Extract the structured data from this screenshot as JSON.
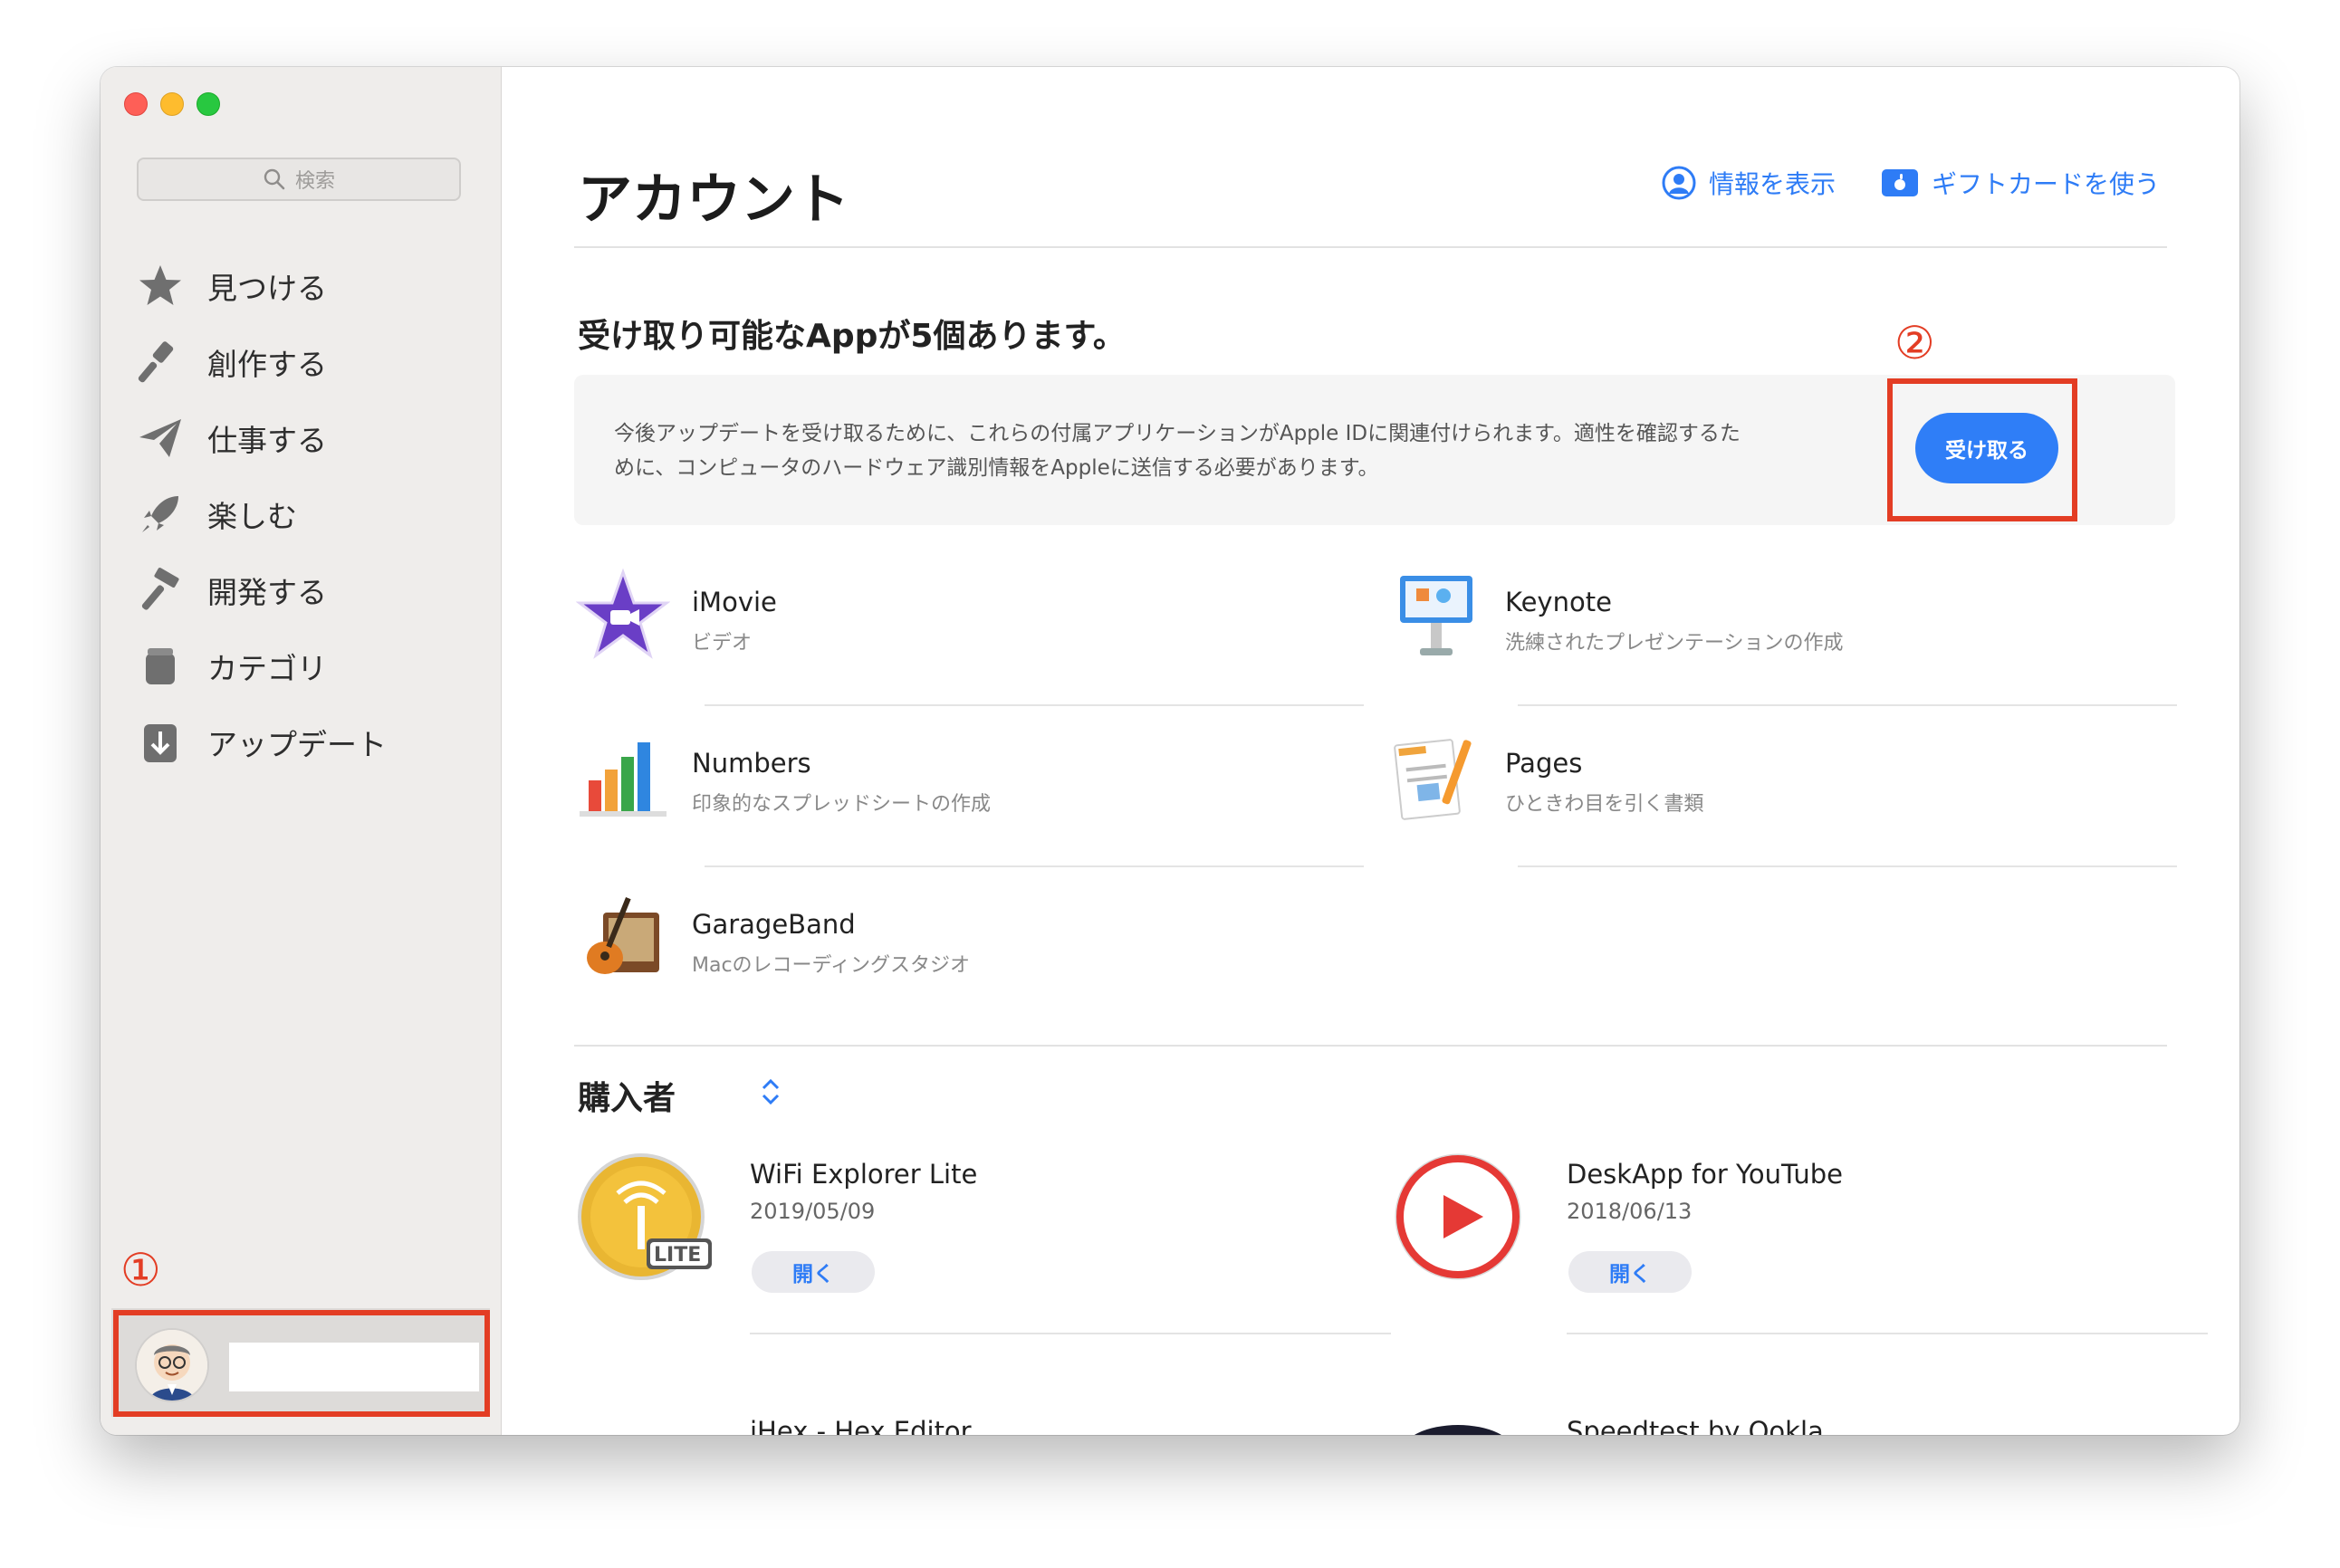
{
  "sidebar": {
    "search_placeholder": "検索",
    "items": [
      {
        "label": "見つける",
        "icon": "star-icon"
      },
      {
        "label": "創作する",
        "icon": "brush-icon"
      },
      {
        "label": "仕事する",
        "icon": "paper-plane-icon"
      },
      {
        "label": "楽しむ",
        "icon": "rocket-icon"
      },
      {
        "label": "開発する",
        "icon": "hammer-icon"
      },
      {
        "label": "カテゴリ",
        "icon": "categories-icon"
      },
      {
        "label": "アップデート",
        "icon": "download-icon"
      }
    ]
  },
  "annotations": {
    "marker_1": "①",
    "marker_2": "②"
  },
  "header": {
    "title": "アカウント",
    "view_info": "情報を表示",
    "gift_card": "ギフトカードを使う"
  },
  "bundled": {
    "heading": "受け取り可能なAppが5個あります。",
    "notice_line1": "今後アップデートを受け取るために、これらの付属アプリケーションがApple IDに関連付けられます。適性を確認するた",
    "notice_line2": "めに、コンピュータのハードウェア識別情報をAppleに送信する必要があります。",
    "redeem_label": "受け取る",
    "apps": [
      {
        "name": "iMovie",
        "desc": "ビデオ"
      },
      {
        "name": "Keynote",
        "desc": "洗練されたプレゼンテーションの作成"
      },
      {
        "name": "Numbers",
        "desc": "印象的なスプレッドシートの作成"
      },
      {
        "name": "Pages",
        "desc": "ひときわ目を引く書類"
      },
      {
        "name": "GarageBand",
        "desc": "Macのレコーディングスタジオ"
      }
    ]
  },
  "purchased": {
    "heading": "購入者",
    "items": [
      {
        "name": "WiFi Explorer Lite",
        "date": "2019/05/09",
        "action": "開く"
      },
      {
        "name": "DeskApp for YouTube",
        "date": "2018/06/13",
        "action": "開く"
      },
      {
        "name": "iHex - Hex Editor"
      },
      {
        "name": "Speedtest by Ookla"
      }
    ]
  },
  "colors": {
    "accent": "#2e7cf6",
    "annotation_red": "#e33d24"
  }
}
